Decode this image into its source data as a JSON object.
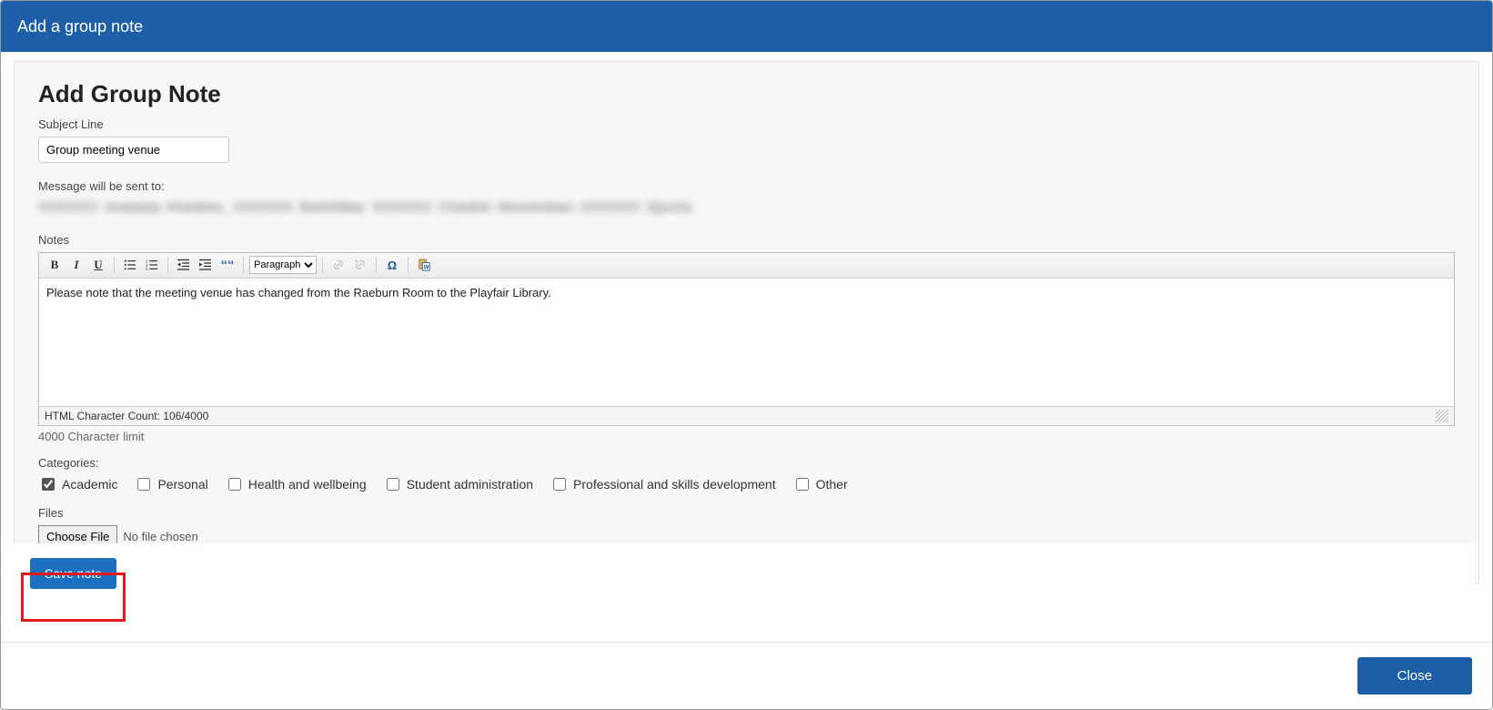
{
  "modal": {
    "title": "Add a group note",
    "close_label": "Close"
  },
  "form": {
    "title": "Add Group Note",
    "subject_label": "Subject Line",
    "subject_value": "Group meeting venue",
    "recipients_label": "Message will be sent to:",
    "recipients_text": "XXXXXXX  Anastasia Khardeen,  XXXXXXX  BashriMbar  XXXXXXX  Chandrei Meunenshavi  XXXXXXX  Djurcha",
    "notes_label": "Notes",
    "notes_body": "Please note that the meeting venue has changed from the Raeburn Room to the Playfair Library.",
    "char_count_label": "HTML Character Count: 106/4000",
    "char_limit_label": "4000 Character limit",
    "categories_label": "Categories:",
    "categories": [
      {
        "label": "Academic",
        "checked": true
      },
      {
        "label": "Personal",
        "checked": false
      },
      {
        "label": "Health and wellbeing",
        "checked": false
      },
      {
        "label": "Student administration",
        "checked": false
      },
      {
        "label": "Professional and skills development",
        "checked": false
      },
      {
        "label": "Other",
        "checked": false
      }
    ],
    "files_label": "Files",
    "choose_file_label": "Choose File",
    "no_file_label": "No file chosen",
    "save_label": "Save note"
  },
  "toolbar": {
    "format_select_value": "Paragraph"
  }
}
